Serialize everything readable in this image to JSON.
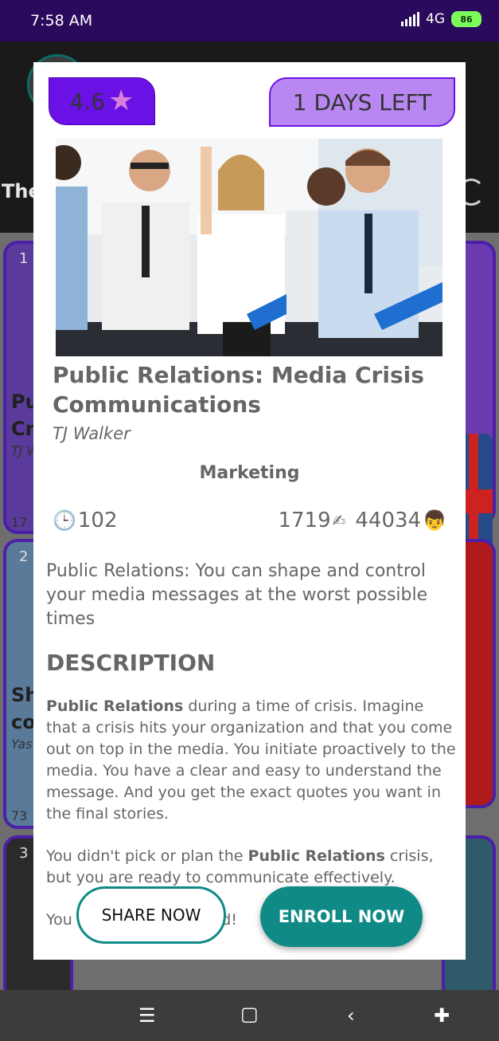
{
  "status_bar": {
    "time": "7:58 AM",
    "network": "4G",
    "battery": "86"
  },
  "modal": {
    "rating": "4.6",
    "days_left": "1 DAYS LEFT",
    "course_title": "Public Relations: Media Crisis Communications",
    "author": "TJ Walker",
    "category": "Marketing",
    "lectures": "102",
    "reviews": "1719",
    "students": "44034",
    "subtitle": "Public Relations: You can shape and control your media messages at the worst possible times",
    "description_heading": "DESCRIPTION",
    "description": {
      "p1_bold": "Public Relations",
      "p1_rest": " during a time of crisis. Imagine that a crisis hits your organization and that you come out on top in the media. You initiate proactively to the media. You have a clear and easy to understand the message. And you get the exact quotes you want in the final stories.",
      "p2_pre": "You didn't pick or plan the ",
      "p2_bold": "Public Relations",
      "p2_post": " crisis, but you are ready to communicate effectively.",
      "p3": "You ... jus ... reput ... red!"
    },
    "share_button": "SHARE NOW",
    "enroll_button": "ENROLL NOW"
  },
  "background": {
    "header_title": "The",
    "cards": [
      {
        "number": "1",
        "title_frag_1": "Pu",
        "title_frag_2": "Cr",
        "author_frag": "TJ W",
        "count_frag": "17"
      },
      {
        "number": "2",
        "title_frag_1": "Sh",
        "title_frag_2": "co",
        "author_frag": "Yas",
        "count_frag": "73"
      },
      {
        "number": "3"
      }
    ]
  },
  "icons": {
    "rating": "star-icon",
    "lectures": "clock-icon",
    "reviews": "writing-hand-icon",
    "students": "person-icon"
  },
  "colors": {
    "status_bar": "#2a0a5c",
    "rating_badge": "#6a11e6",
    "days_badge": "#b987f2",
    "accent_teal": "#0f8a86"
  }
}
